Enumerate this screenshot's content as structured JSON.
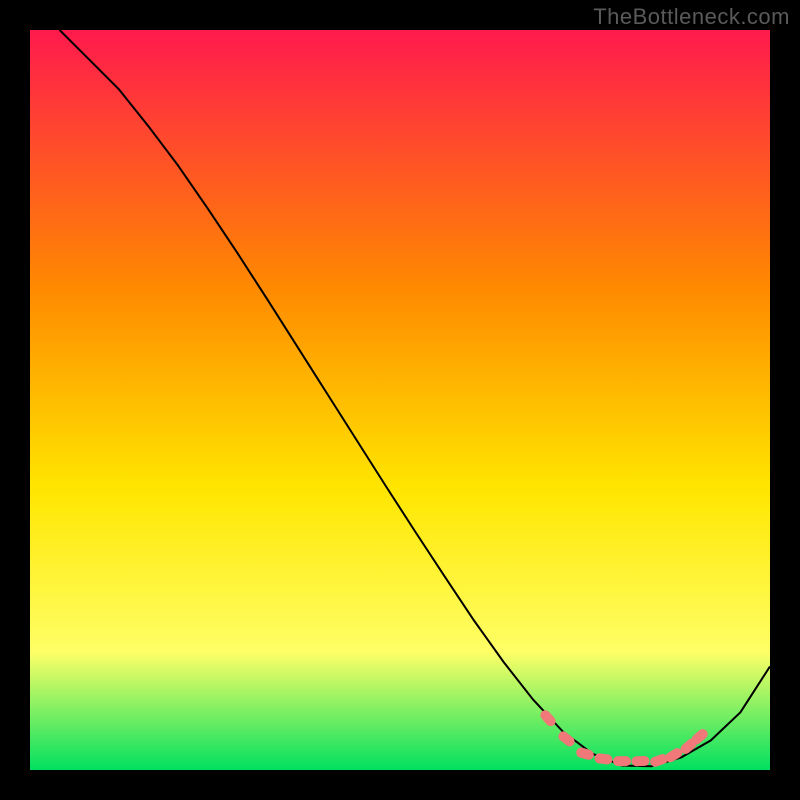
{
  "watermark": "TheBottleneck.com",
  "colors": {
    "frame": "#000000",
    "curve": "#000000",
    "marker_fill": "#f07878",
    "marker_stroke": "#e86a6a",
    "gradient_top": "#ff1a4d",
    "gradient_mid1": "#ff8a00",
    "gradient_mid2": "#ffe600",
    "gradient_mid3": "#ffff66",
    "gradient_bottom": "#00e060"
  },
  "chart_data": {
    "type": "line",
    "title": "",
    "xlabel": "",
    "ylabel": "",
    "xlim": [
      0,
      100
    ],
    "ylim": [
      0,
      100
    ],
    "curve": [
      {
        "x": 4.0,
        "y": 100.0
      },
      {
        "x": 8.0,
        "y": 96.0
      },
      {
        "x": 12.0,
        "y": 92.0
      },
      {
        "x": 16.0,
        "y": 87.0
      },
      {
        "x": 20.0,
        "y": 81.7
      },
      {
        "x": 24.0,
        "y": 75.9
      },
      {
        "x": 28.0,
        "y": 69.9
      },
      {
        "x": 32.0,
        "y": 63.7
      },
      {
        "x": 36.0,
        "y": 57.4
      },
      {
        "x": 40.0,
        "y": 51.1
      },
      {
        "x": 44.0,
        "y": 44.8
      },
      {
        "x": 48.0,
        "y": 38.5
      },
      {
        "x": 52.0,
        "y": 32.3
      },
      {
        "x": 56.0,
        "y": 26.2
      },
      {
        "x": 60.0,
        "y": 20.2
      },
      {
        "x": 64.0,
        "y": 14.6
      },
      {
        "x": 68.0,
        "y": 9.5
      },
      {
        "x": 72.0,
        "y": 5.2
      },
      {
        "x": 76.0,
        "y": 2.2
      },
      {
        "x": 80.0,
        "y": 0.6
      },
      {
        "x": 84.0,
        "y": 0.5
      },
      {
        "x": 88.0,
        "y": 1.7
      },
      {
        "x": 92.0,
        "y": 4.0
      },
      {
        "x": 96.0,
        "y": 7.8
      },
      {
        "x": 100.0,
        "y": 14.0
      }
    ],
    "markers": [
      {
        "x": 70.0,
        "y": 7.0
      },
      {
        "x": 72.5,
        "y": 4.2
      },
      {
        "x": 75.0,
        "y": 2.2
      },
      {
        "x": 77.5,
        "y": 1.5
      },
      {
        "x": 80.0,
        "y": 1.2
      },
      {
        "x": 82.5,
        "y": 1.2
      },
      {
        "x": 85.0,
        "y": 1.3
      },
      {
        "x": 87.0,
        "y": 2.0
      },
      {
        "x": 89.0,
        "y": 3.2
      },
      {
        "x": 90.5,
        "y": 4.5
      }
    ]
  }
}
